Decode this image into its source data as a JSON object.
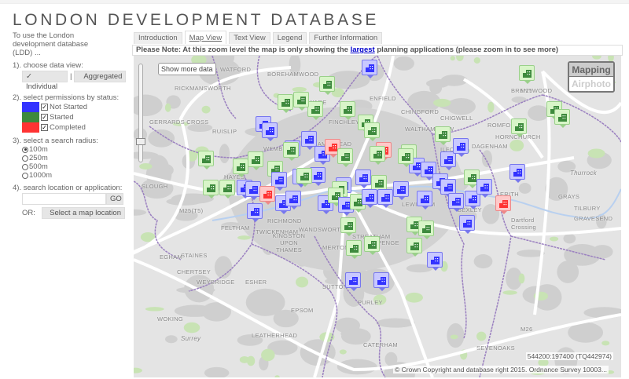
{
  "title": "LONDON DEVELOPMENT DATABASE",
  "sidebar": {
    "intro": "To use the London development database (LDD) ...",
    "step1": "1). choose data view:",
    "view_individual": "Individual",
    "view_sep": "|",
    "view_aggregated": "Aggregated",
    "step2": "2). select permissions by status:",
    "statuses": [
      {
        "label": "Not Started",
        "color": "#3333ff",
        "checked": true
      },
      {
        "label": "Started",
        "color": "#3d8a3d",
        "checked": true
      },
      {
        "label": "Completed",
        "color": "#ff3333",
        "checked": true
      }
    ],
    "step3": "3). select a search radius:",
    "radii": [
      {
        "label": "100m",
        "selected": true
      },
      {
        "label": "250m",
        "selected": false
      },
      {
        "label": "500m",
        "selected": false
      },
      {
        "label": "1000m",
        "selected": false
      }
    ],
    "step4": "4). search location or application:",
    "search_value": "",
    "go": "GO",
    "or": "OR:",
    "select_map": "Select a map location"
  },
  "tabs": [
    {
      "label": "Introduction"
    },
    {
      "label": "Map View",
      "active": true
    },
    {
      "label": "Text View"
    },
    {
      "label": "Legend"
    },
    {
      "label": "Further Information"
    }
  ],
  "notice": {
    "pre": "Please Note: At this zoom level the map is only showing the ",
    "link": "largest",
    "post": " planning applications (please zoom in to see more)"
  },
  "map": {
    "show_more": "Show more data",
    "layers": {
      "mapping": "Mapping",
      "airphoto": "Airphoto",
      "selected": "Mapping"
    },
    "coords": "544200:197400 (TQ442974)",
    "copyright": "© Crown Copyright and database right 2015. Ordnance Survey 10003...",
    "places": [
      "WATFORD",
      "BOREHAMWOOD",
      "ENFIELD",
      "CHINGFORD",
      "CHIGWELL",
      "BRENTWOOD",
      "RICKMANSWORTH",
      "GERRARDS CROSS",
      "RUISLIP",
      "EDGWARE",
      "FINCHLEY",
      "HAMPSTEAD",
      "WALTHAMSTOW",
      "ILFORD",
      "ROMFORD",
      "HORNCHURCH",
      "DAGENHAM",
      "HAYES",
      "SLOUGH",
      "WEMBLEY",
      "FELTHAM",
      "STAINES",
      "EGHAM",
      "TWICKENHAM",
      "RICHMOND",
      "WANDSWORTH",
      "STREATHAM",
      "MERTON",
      "KINGSTON UPON THAMES",
      "CHERTSEY",
      "WEYBRIDGE",
      "ESHER",
      "SUTTON",
      "PURLEY",
      "EPSOM",
      "WOKING",
      "LEATHERHEAD",
      "CATERHAM",
      "SEVENOAKS",
      "LEWISHAM",
      "PENGE",
      "BEXLEY",
      "ERITH",
      "GRAYS",
      "TILBURY",
      "GRAVESEND",
      "Dartford Crossing",
      "Thurrock",
      "Surrey",
      "M25",
      "M25(T5)",
      "M26"
    ],
    "status_colors": {
      "not_started": "#3333ff",
      "started": "#3d8a3d",
      "completed": "#ff3333"
    }
  }
}
